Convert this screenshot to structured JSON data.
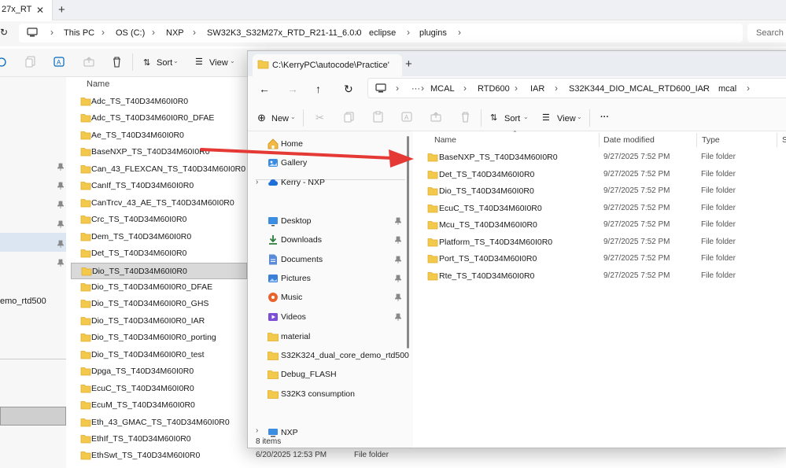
{
  "background_window": {
    "tab_title": "27x_RT",
    "tab_close": "✕",
    "tab_add": "+",
    "breadcrumb": [
      "This PC",
      "OS (C:)",
      "NXP",
      "SW32K3_S32M27x_RTD_R21-11_6.0.0",
      "eclipse",
      "plugins"
    ],
    "search_placeholder": "Search p",
    "toolbar": {
      "sort": "Sort",
      "view": "View"
    },
    "column_name": "Name",
    "nav_text": "emo_rtd500",
    "files": [
      "Adc_TS_T40D34M60I0R0",
      "Adc_TS_T40D34M60I0R0_DFAE",
      "Ae_TS_T40D34M60I0R0",
      "BaseNXP_TS_T40D34M60I0R0",
      "Can_43_FLEXCAN_TS_T40D34M60I0R0",
      "CanIf_TS_T40D34M60I0R0",
      "CanTrcv_43_AE_TS_T40D34M60I0R0",
      "Crc_TS_T40D34M60I0R0",
      "Dem_TS_T40D34M60I0R0",
      "Det_TS_T40D34M60I0R0",
      "Dio_TS_T40D34M60I0R0",
      "Dio_TS_T40D34M60I0R0_DFAE",
      "Dio_TS_T40D34M60I0R0_GHS",
      "Dio_TS_T40D34M60I0R0_IAR",
      "Dio_TS_T40D34M60I0R0_porting",
      "Dio_TS_T40D34M60I0R0_test",
      "Dpga_TS_T40D34M60I0R0",
      "EcuC_TS_T40D34M60I0R0",
      "EcuM_TS_T40D34M60I0R0",
      "Eth_43_GMAC_TS_T40D34M60I0R0",
      "EthIf_TS_T40D34M60I0R0",
      "EthSwt_TS_T40D34M60I0R0"
    ],
    "selected_file": "Dio_TS_T40D34M60I0R0",
    "status_date": "6/20/2025 12:53 PM",
    "status_type": "File folder"
  },
  "foreground_window": {
    "tab_title": "C:\\KerryPC\\autocode\\Practice'",
    "tab_add": "+",
    "breadcrumb": [
      "MCAL",
      "RTD600",
      "IAR",
      "S32K344_DIO_MCAL_RTD600_IAR",
      "mcal"
    ],
    "ellipsis": "···",
    "toolbar": {
      "new": "New",
      "sort": "Sort",
      "view": "View",
      "more": "···"
    },
    "nav": [
      {
        "label": "Home",
        "icon": "home-icon"
      },
      {
        "label": "Gallery",
        "icon": "gallery-icon"
      },
      {
        "label": "Kerry - NXP",
        "icon": "cloud-icon"
      },
      {
        "label": "Desktop",
        "icon": "desktop-icon",
        "pinned": true
      },
      {
        "label": "Downloads",
        "icon": "download-icon",
        "pinned": true
      },
      {
        "label": "Documents",
        "icon": "documents-icon",
        "pinned": true
      },
      {
        "label": "Pictures",
        "icon": "pictures-icon",
        "pinned": true
      },
      {
        "label": "Music",
        "icon": "music-icon",
        "pinned": true
      },
      {
        "label": "Videos",
        "icon": "videos-icon",
        "pinned": true
      },
      {
        "label": "material",
        "icon": "folder-icon"
      },
      {
        "label": "S32K324_dual_core_demo_rtd500",
        "icon": "folder-icon"
      },
      {
        "label": "Debug_FLASH",
        "icon": "folder-icon"
      },
      {
        "label": "S32K3 consumption",
        "icon": "folder-icon"
      },
      {
        "label": "NXP",
        "icon": "pc-icon"
      }
    ],
    "columns": {
      "name": "Name",
      "date": "Date modified",
      "type": "Type",
      "size": "S"
    },
    "files": [
      {
        "name": "BaseNXP_TS_T40D34M60I0R0",
        "date": "9/27/2025 7:52 PM",
        "type": "File folder"
      },
      {
        "name": "Det_TS_T40D34M60I0R0",
        "date": "9/27/2025 7:52 PM",
        "type": "File folder"
      },
      {
        "name": "Dio_TS_T40D34M60I0R0",
        "date": "9/27/2025 7:52 PM",
        "type": "File folder"
      },
      {
        "name": "EcuC_TS_T40D34M60I0R0",
        "date": "9/27/2025 7:52 PM",
        "type": "File folder"
      },
      {
        "name": "Mcu_TS_T40D34M60I0R0",
        "date": "9/27/2025 7:52 PM",
        "type": "File folder"
      },
      {
        "name": "Platform_TS_T40D34M60I0R0",
        "date": "9/27/2025 7:52 PM",
        "type": "File folder"
      },
      {
        "name": "Port_TS_T40D34M60I0R0",
        "date": "9/27/2025 7:52 PM",
        "type": "File folder"
      },
      {
        "name": "Rte_TS_T40D34M60I0R0",
        "date": "9/27/2025 7:52 PM",
        "type": "File folder"
      }
    ],
    "status": "8 items"
  },
  "colors": {
    "folder": "#f2c94c",
    "folder_dark": "#e0ad2a",
    "arrow": "#e53935",
    "selection": "#d9d9d9",
    "accent": "#0067c0"
  }
}
